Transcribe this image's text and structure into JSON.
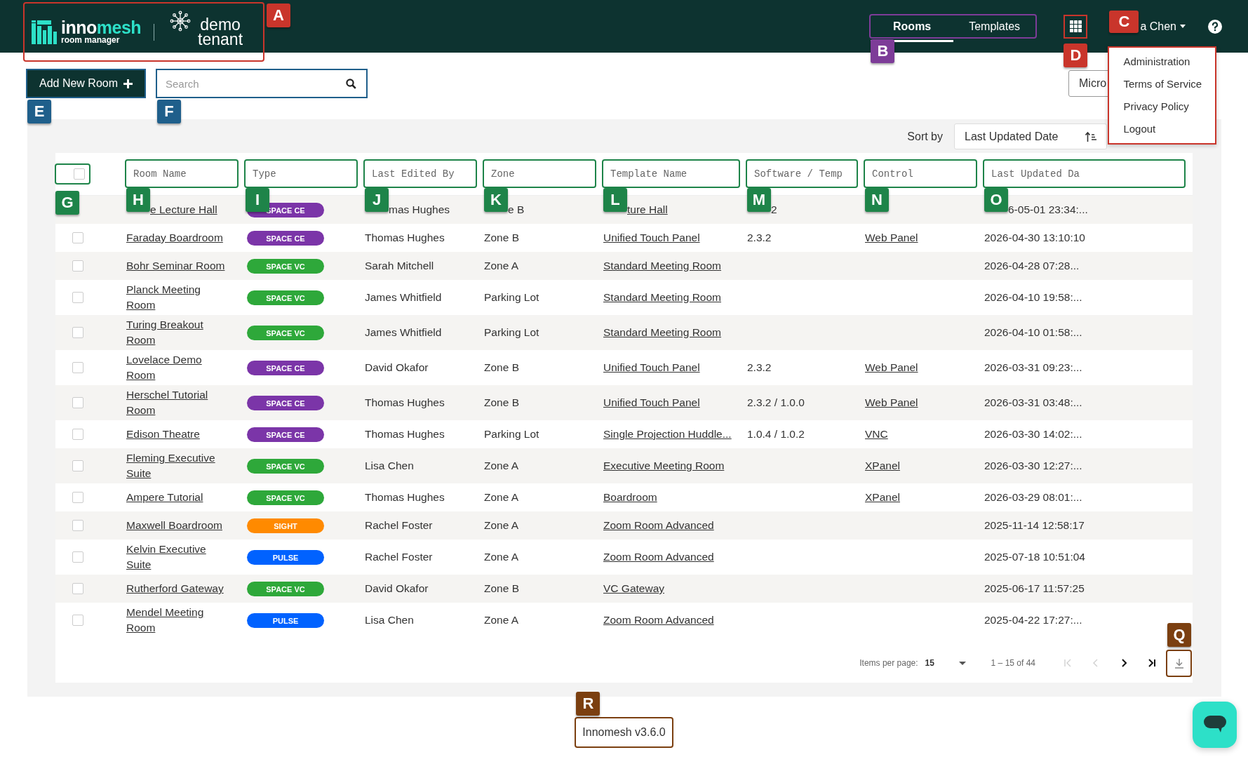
{
  "header": {
    "brand": {
      "name_part_1": "inno",
      "name_part_2": "mesh",
      "subtitle": "room manager",
      "tenant": "demo tenant",
      "annotation": {
        "label": "A",
        "color": "#c9352b"
      }
    },
    "nav_tabs": {
      "items": [
        {
          "label": "Rooms",
          "selected": true
        },
        {
          "label": "Templates",
          "selected": false
        }
      ],
      "annotation": {
        "label": "B",
        "color": "#7d3c98"
      }
    },
    "apps_button": {
      "annotation": {
        "label": "D",
        "color": "#c9352b"
      }
    },
    "user_menu": {
      "label": "a Chen",
      "expanded": true,
      "annotation": {
        "label": "C",
        "color": "#c9352b"
      },
      "items": [
        "Administration",
        "Terms of Service",
        "Privacy Policy",
        "Logout"
      ]
    }
  },
  "toolbar": {
    "add_button": {
      "label": "Add New Room",
      "annotation": {
        "label": "E",
        "color": "#1f5f8b"
      }
    },
    "search": {
      "placeholder": "Search",
      "annotation": {
        "label": "F",
        "color": "#1f5f8b"
      }
    },
    "partial_button": {
      "label": "Micro"
    }
  },
  "sort": {
    "label": "Sort by",
    "value": "Last Updated Date"
  },
  "table": {
    "select_all": {
      "checked": false,
      "annotation": {
        "label": "G",
        "color": "#1e8449"
      }
    },
    "columns": [
      {
        "label": "Room Name",
        "annotation": {
          "label": "H",
          "color": "#1e8449"
        }
      },
      {
        "label": "Type",
        "annotation": {
          "label": "I",
          "color": "#1e8449"
        }
      },
      {
        "label": "Last Edited By",
        "annotation": {
          "label": "J",
          "color": "#1e8449"
        }
      },
      {
        "label": "Zone",
        "annotation": {
          "label": "K",
          "color": "#1e8449"
        }
      },
      {
        "label": "Template Name",
        "annotation": {
          "label": "L",
          "color": "#1e8449"
        }
      },
      {
        "label": "Software / Temp",
        "annotation": {
          "label": "M",
          "color": "#1e8449"
        }
      },
      {
        "label": "Control",
        "annotation": {
          "label": "N",
          "color": "#1e8449"
        }
      },
      {
        "label": "Last Updated Da",
        "annotation": {
          "label": "O",
          "color": "#1e8449"
        }
      }
    ],
    "rows": [
      {
        "room": "e Lecture Hall",
        "type": {
          "label": "SPACE CE",
          "color": "#7b35a8"
        },
        "edited_by": "mas Hughes",
        "zone": "e B",
        "template": "ture Hall",
        "software": "2",
        "updated": "6-05-01 23:34:..."
      },
      {
        "checked": false,
        "room": "Faraday Boardroom",
        "type": {
          "label": "SPACE CE",
          "color": "#7b35a8"
        },
        "edited_by": "Thomas Hughes",
        "zone": "Zone B",
        "template": "Unified Touch Panel",
        "software": "2.3.2",
        "control": "Web Panel",
        "updated": "2026-04-30 13:10:10"
      },
      {
        "checked": false,
        "room": "Bohr Seminar Room",
        "type": {
          "label": "SPACE VC",
          "color": "#2ea83a"
        },
        "edited_by": "Sarah Mitchell",
        "zone": "Zone A",
        "template": "Standard Meeting Room",
        "updated": "2026-04-28 07:28..."
      },
      {
        "checked": false,
        "room": "Planck Meeting Room",
        "type": {
          "label": "SPACE VC",
          "color": "#2ea83a"
        },
        "edited_by": "James Whitfield",
        "zone": "Parking Lot",
        "template": "Standard Meeting Room",
        "updated": "2026-04-10 19:58:..."
      },
      {
        "checked": false,
        "room": "Turing Breakout Room",
        "type": {
          "label": "SPACE VC",
          "color": "#2ea83a"
        },
        "edited_by": "James Whitfield",
        "zone": "Parking Lot",
        "template": "Standard Meeting Room",
        "updated": "2026-04-10 01:58:..."
      },
      {
        "checked": false,
        "room": "Lovelace Demo Room",
        "type": {
          "label": "SPACE CE",
          "color": "#7b35a8"
        },
        "edited_by": "David Okafor",
        "zone": "Zone B",
        "template": "Unified Touch Panel",
        "software": "2.3.2",
        "control": "Web Panel",
        "updated": "2026-03-31 09:23:..."
      },
      {
        "checked": false,
        "room": "Herschel Tutorial Room",
        "type": {
          "label": "SPACE CE",
          "color": "#7b35a8"
        },
        "edited_by": "Thomas Hughes",
        "zone": "Zone B",
        "template": "Unified Touch Panel",
        "software": "2.3.2 / 1.0.0",
        "control": "Web Panel",
        "updated": "2026-03-31 03:48:..."
      },
      {
        "checked": false,
        "room": "Edison Theatre",
        "type": {
          "label": "SPACE CE",
          "color": "#7b35a8"
        },
        "edited_by": "Thomas Hughes",
        "zone": "Parking Lot",
        "template": "Single Projection Huddle...",
        "software": "1.0.4 / 1.0.2",
        "control": "VNC",
        "updated": "2026-03-30 14:02:..."
      },
      {
        "checked": false,
        "room": "Fleming Executive Suite",
        "type": {
          "label": "SPACE VC",
          "color": "#2ea83a"
        },
        "edited_by": "Lisa Chen",
        "zone": "Zone A",
        "template": "Executive Meeting Room",
        "control": "XPanel",
        "updated": "2026-03-30 12:27:..."
      },
      {
        "checked": false,
        "room": "Ampere Tutorial",
        "type": {
          "label": "SPACE VC",
          "color": "#2ea83a"
        },
        "edited_by": "Thomas Hughes",
        "zone": "Zone A",
        "template": "Boardroom",
        "control": "XPanel",
        "updated": "2026-03-29 08:01:..."
      },
      {
        "checked": false,
        "room": "Maxwell Boardroom",
        "type": {
          "label": "SIGHT",
          "color": "#ff8a00"
        },
        "edited_by": "Rachel Foster",
        "zone": "Zone A",
        "template": "Zoom Room Advanced",
        "updated": "2025-11-14 12:58:17"
      },
      {
        "checked": false,
        "room": "Kelvin Executive Suite",
        "type": {
          "label": "PULSE",
          "color": "#0062ff"
        },
        "edited_by": "Rachel Foster",
        "zone": "Zone A",
        "template": "Zoom Room Advanced",
        "updated": "2025-07-18 10:51:04"
      },
      {
        "checked": false,
        "room": "Rutherford Gateway",
        "type": {
          "label": "SPACE VC",
          "color": "#2ea83a"
        },
        "edited_by": "David Okafor",
        "zone": "Zone B",
        "template": "VC Gateway",
        "updated": "2025-06-17 11:57:25"
      },
      {
        "checked": false,
        "room": "Mendel Meeting Room",
        "type": {
          "label": "PULSE",
          "color": "#0062ff"
        },
        "edited_by": "Lisa Chen",
        "zone": "Zone A",
        "template": "Zoom Room Advanced",
        "updated": "2025-04-22 17:27:..."
      }
    ]
  },
  "pagination": {
    "items_per_page_label": "Items per page:",
    "items_per_page": "15",
    "range": "1 – 15 of 44",
    "buttons": [
      {
        "kind": "first",
        "disabled": true
      },
      {
        "kind": "prev",
        "disabled": true
      },
      {
        "kind": "next",
        "disabled": false
      },
      {
        "kind": "last",
        "disabled": false
      }
    ],
    "download_button": {
      "annotation": {
        "label": "Q",
        "color": "#7b3f10"
      }
    }
  },
  "footer": {
    "version": "Innomesh v3.6.0",
    "annotation": {
      "label": "R",
      "color": "#7b3f10"
    }
  }
}
